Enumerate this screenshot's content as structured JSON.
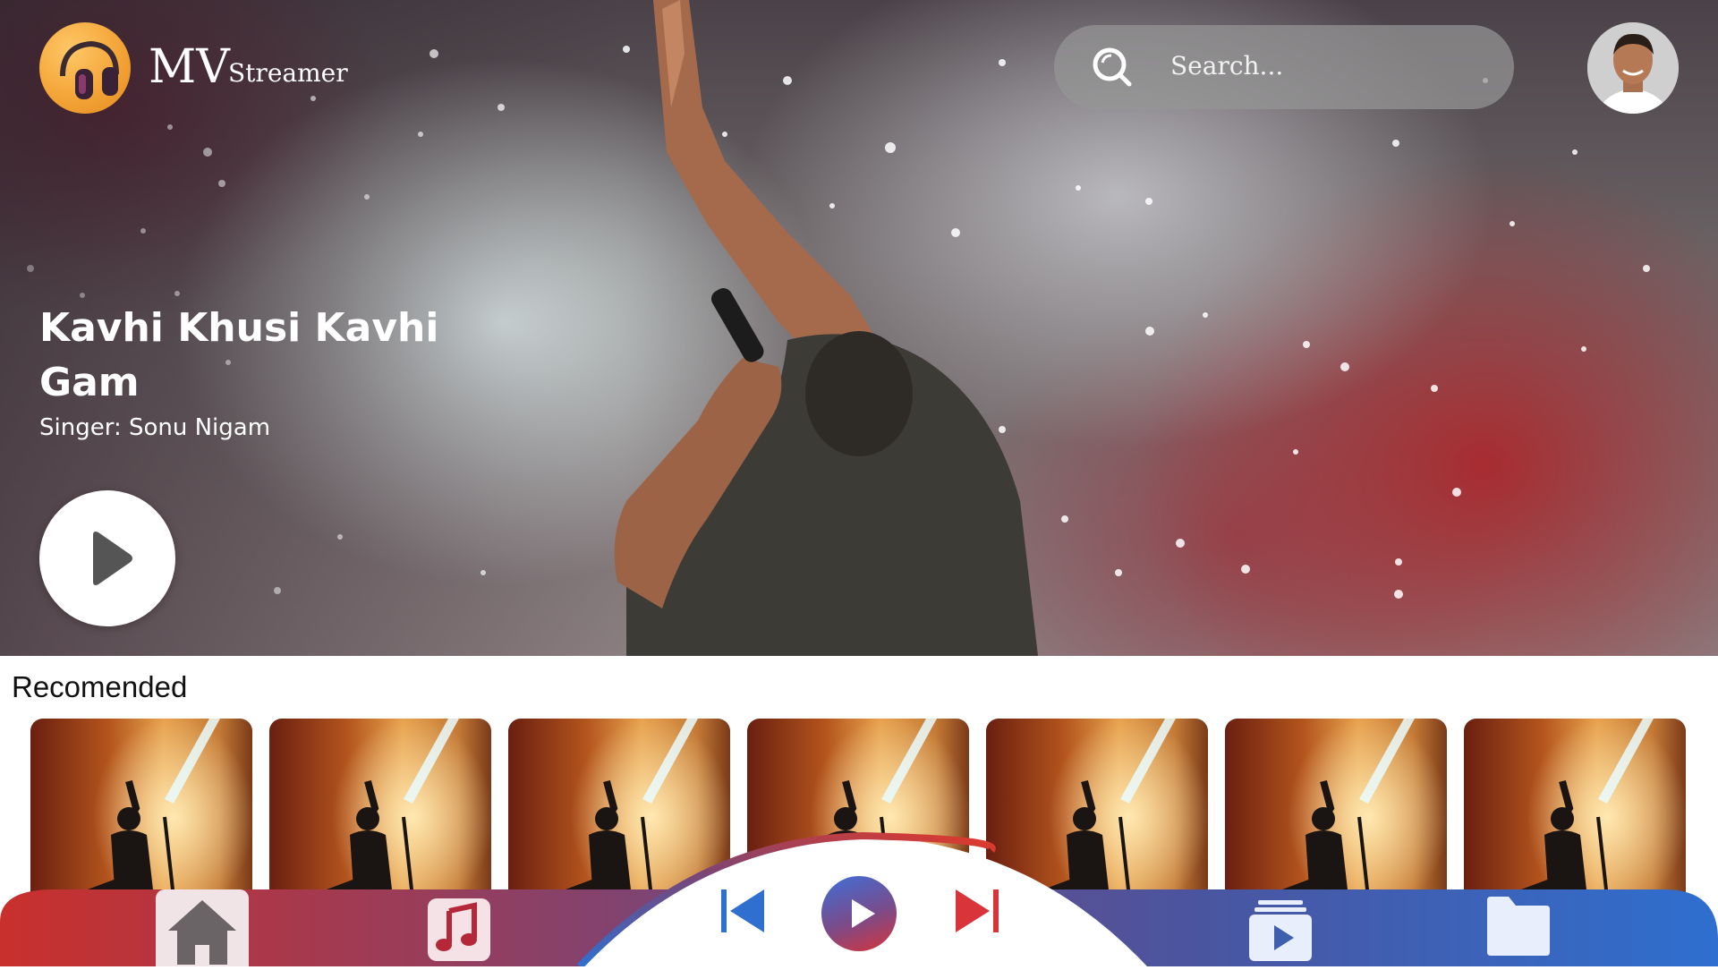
{
  "app": {
    "brand_main": "MV",
    "brand_sub": "Streamer"
  },
  "search": {
    "placeholder": "Search..."
  },
  "featured": {
    "title": "Kavhi Khusi Kavhi Gam",
    "singer": "Singer: Sonu Nigam"
  },
  "recommended": {
    "label": "Recomended",
    "items": [
      {
        "icon": "concert-thumbnail"
      },
      {
        "icon": "concert-thumbnail"
      },
      {
        "icon": "concert-thumbnail"
      },
      {
        "icon": "concert-thumbnail"
      },
      {
        "icon": "concert-thumbnail"
      },
      {
        "icon": "concert-thumbnail"
      },
      {
        "icon": "concert-thumbnail"
      }
    ]
  },
  "nav": {
    "items": [
      "home-icon",
      "music-note-icon",
      "previous-icon",
      "play-icon",
      "next-icon",
      "playlist-icon",
      "folder-icon"
    ]
  },
  "colors": {
    "nav_red": "#c9302c",
    "nav_blue": "#2f6fcf",
    "logo_orange": "#f2a234",
    "search_bg": "#969696"
  }
}
